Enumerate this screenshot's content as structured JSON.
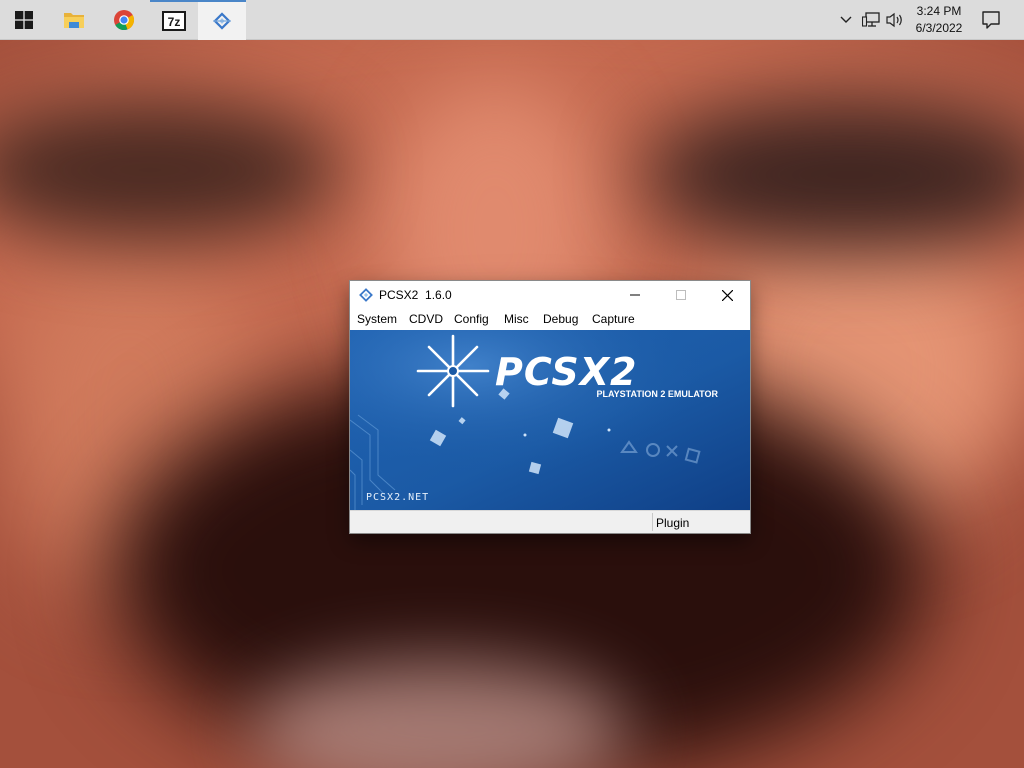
{
  "taskbar": {
    "start_icon": "windows-logo-icon",
    "apps": [
      {
        "name": "File Explorer",
        "icon": "folder-icon"
      },
      {
        "name": "Google Chrome",
        "icon": "chrome-icon"
      },
      {
        "name": "7-Zip",
        "icon": "7zip-icon",
        "label": "7z"
      },
      {
        "name": "PCSX2",
        "icon": "pcsx2-icon",
        "active": true
      }
    ],
    "tray": {
      "chevron": "chevron-up-icon",
      "network": "network-icon",
      "volume": "volume-icon",
      "time": "3:24 PM",
      "date": "6/3/2022",
      "notification": "notification-icon"
    },
    "accent_color": "#4a86c8"
  },
  "window": {
    "title": "PCSX2  1.6.0",
    "menu": [
      "System",
      "CDVD",
      "Config",
      "Misc",
      "Debug",
      "Capture"
    ],
    "banner": {
      "logo_text": "PCSX2",
      "subtitle": "PLAYSTATION 2 EMULATOR",
      "url": "PCSX2.NET",
      "bg_color": "#1d5ea8"
    },
    "status": {
      "plugin": "Plugin"
    }
  }
}
